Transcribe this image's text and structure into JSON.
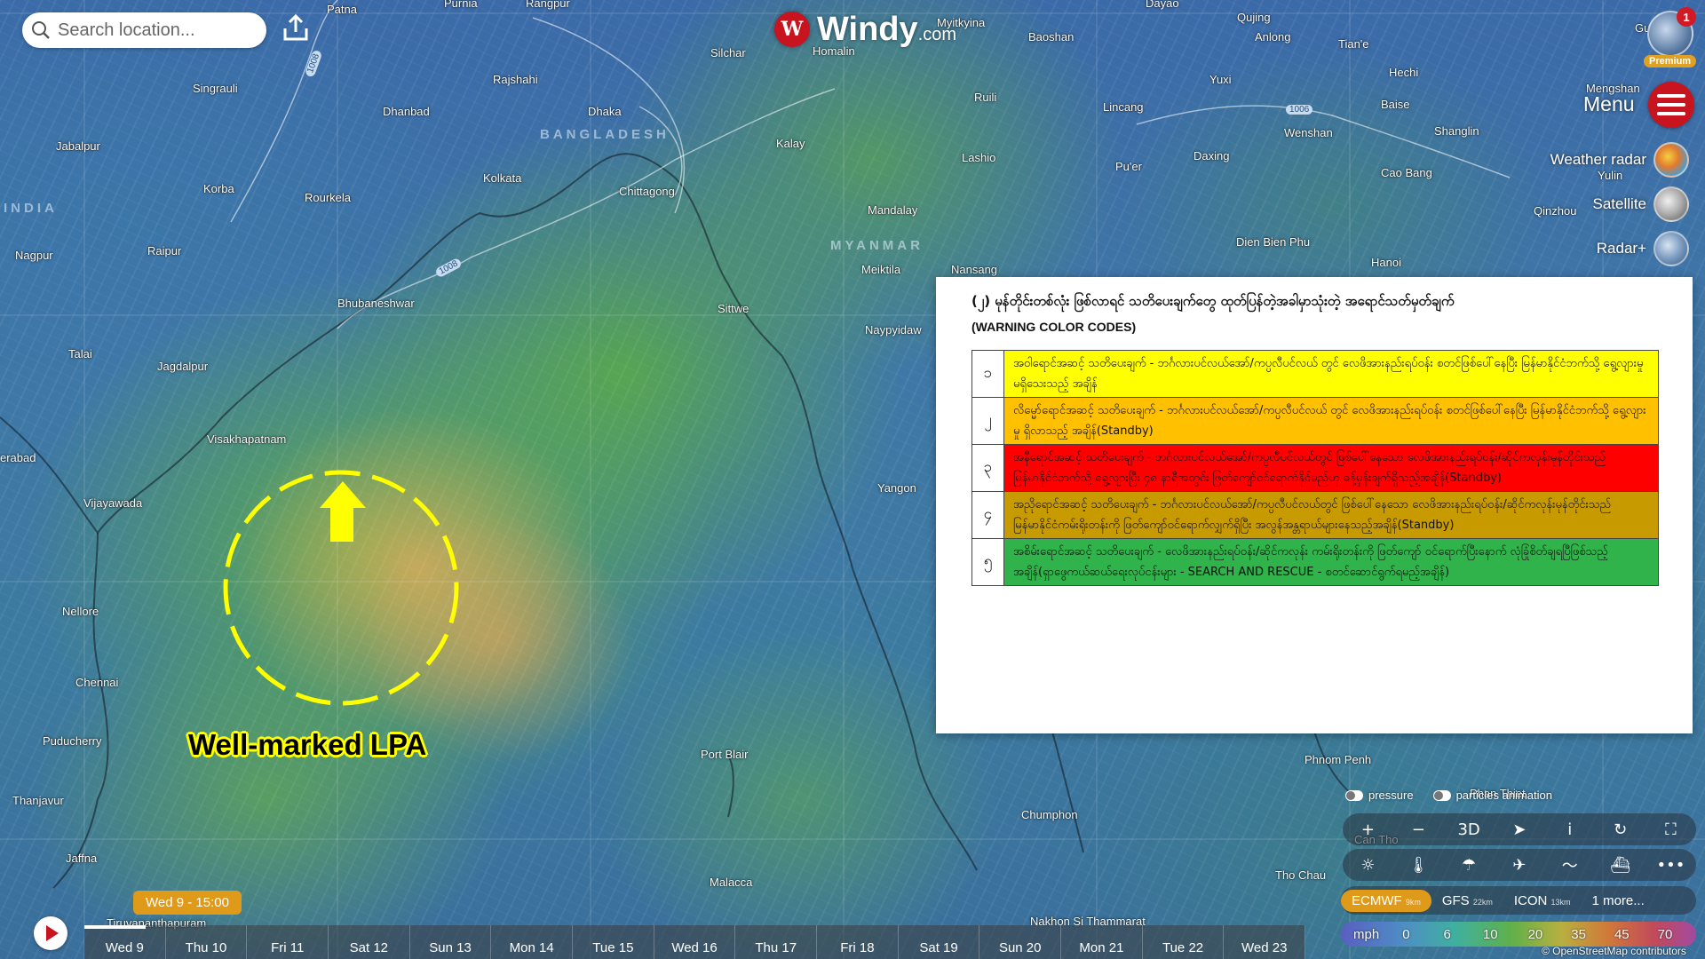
{
  "app": {
    "brand": "Windy",
    "brand_suffix": ".com",
    "logo_letter": "W"
  },
  "search": {
    "placeholder": "Search location..."
  },
  "user": {
    "notifications": "1",
    "badge": "Premium"
  },
  "menu": {
    "label": "Menu"
  },
  "layers": [
    {
      "label": "Weather radar",
      "icon": "radar-thumbnail"
    },
    {
      "label": "Satellite",
      "icon": "satellite-thumbnail"
    },
    {
      "label": "Radar+",
      "icon": "radar-plus-thumbnail"
    }
  ],
  "map": {
    "cities": [
      "Patna",
      "Purnia",
      "Rangpur",
      "Myitkyina",
      "Dayao",
      "Qujing",
      "Guilin",
      "Anlong",
      "Tian'e",
      "Silchar",
      "Homalin",
      "Baoshan",
      "Singrauli",
      "Rajshahi",
      "Dhaka",
      "Ruili",
      "Lincang",
      "Yuxi",
      "Baise",
      "Hechi",
      "Mengshan",
      "Jabalpur",
      "Dhanbad",
      "Kalay",
      "Lashio",
      "Pu'er",
      "Daxing",
      "Wenshan",
      "Shanglin",
      "Korba",
      "Rourkela",
      "Kolkata",
      "Chittagong",
      "Mandalay",
      "Cao Bang",
      "Yulin",
      "Qinzhou",
      "Nagpur",
      "Raipur",
      "Meiktila",
      "Nansang",
      "Dien Bien Phu",
      "Hanoi",
      "Bhubaneshwar",
      "Sittwe",
      "Naypyidaw",
      "Talai",
      "Jagdalpur",
      "Visakhapatnam",
      "erabad",
      "Vijayawada",
      "Yangon",
      "Nellore",
      "Chennai",
      "Puducherry",
      "Port Blair",
      "Thanjavur",
      "Jaffna",
      "Chumphon",
      "Phnom Penh",
      "Phan Thiet",
      "Tho Chau",
      "Malacca",
      "Nakhon Si Thammarat",
      "Can Tho",
      "Tiruvananthapuram"
    ],
    "countries": [
      "BANGLADESH",
      "MYANMAR",
      "INDIA"
    ],
    "isobars": [
      "1008",
      "1006",
      "1008"
    ],
    "annotation": "Well-marked LPA"
  },
  "warning_panel": {
    "title": "(၂) မုန်တိုင်းတစ်လုံး ဖြစ်လာရင် သတိပေးချက်တွေ ထုတ်ပြန်တဲ့အခါမှာသုံးတဲ့ အရောင်သတ်မှတ်ချက်",
    "subtitle": "(WARNING COLOR CODES)",
    "rows": [
      {
        "num": "၁",
        "color": "#ffff00",
        "text": "အဝါရောင်အဆင့် သတိပေးချက် - ဘင်္ဂလားပင်လယ်အော်/ကပ္ပလီပင်လယ် တွင် လေဖိအားနည်းရပ်ဝန်း စတင်ဖြစ်ပေါ်နေပြီး မြန်မာနိုင်ငံဘက်သို့ ရွေ့လျားမှု မရှိသေးသည့် အချိန်"
      },
      {
        "num": "၂",
        "color": "#ffc000",
        "text": "လိမ္မော်ရောင်အဆင့် သတိပေးချက် - ဘင်္ဂလားပင်လယ်အော်/ကပ္ပလီပင်လယ် တွင် လေဖိအားနည်းရပ်ဝန်း စတင်ဖြစ်ပေါ်နေပြီး မြန်မာနိုင်ငံဘက်သို့ ရွေ့လျားမှု ရှိလာသည့် အချိန်(Standby)"
      },
      {
        "num": "၃",
        "color": "#ff0000",
        "text": "အနီရောင်အဆင့် သတိပေးချက် - ဘင်္ဂလားပင်လယ်အော်/ကပ္ပလီပင်လယ်တွင် ဖြစ်ပေါ်နေသော လေဖိအားနည်းရပ်ဝန်း/ဆိုင်ကလုန်းမုန်တိုင်းသည် မြန်မာနိုင်ငံဘက်သို့ ရွေ့လျားပြီး ၄၈ နာရီအတွင်း ဖြတ်ကျော်ဝင်ရောက်နိုင်မည်ဟု ခန့်မှန်းချက်ရှိသည့်အချိန်(Standby)"
      },
      {
        "num": "၄",
        "color": "#c79a00",
        "text": "အညိုရောင်အဆင့် သတိပေးချက် - ဘင်္ဂလားပင်လယ်အော်/ကပ္ပလီပင်လယ်တွင် ဖြစ်ပေါ်နေသော လေဖိအားနည်းရပ်ဝန်း/ဆိုင်ကလုန်းမုန်တိုင်းသည် မြန်မာနိုင်ငံကမ်းရိုးတန်းကို ဖြတ်ကျော်ဝင်ရောက်လျှက်ရှိပြီး အလွန်အန္တရာယ်များနေသည့်အချိန်(Standby)"
      },
      {
        "num": "၅",
        "color": "#2fb34a",
        "text": "အစိမ်းရောင်အဆင့် သတိပေးချက် - လေဖိအားနည်းရပ်ဝန်း/ဆိုင်ကလုန်း ကမ်းရိုးတန်းကို ဖြတ်ကျော် ဝင်ရောက်ပြီးနောက် လုံခြုံစိတ်ချရပြီဖြစ်သည့်အချိန်(ရှာဖွေကယ်ဆယ်ရေးလုပ်ငန်းများ - SEARCH AND RESCUE - စတင်ဆောင်ရွက်ရမည့်အချိန်)"
      }
    ]
  },
  "overlays": {
    "pressure": "pressure",
    "particles": "particles animation"
  },
  "tools": [
    "+",
    "−",
    "3D",
    "➤",
    "i",
    "↻",
    "⛶"
  ],
  "layer_tools": [
    "wind-icon",
    "temperature-icon",
    "rain-icon",
    "plane-icon",
    "waves-icon",
    "ship-icon",
    "more-icon"
  ],
  "models": [
    {
      "name": "ECMWF",
      "res": "9km",
      "active": true
    },
    {
      "name": "GFS",
      "res": "22km",
      "active": false
    },
    {
      "name": "ICON",
      "res": "13km",
      "active": false
    },
    {
      "name": "1 more...",
      "res": "",
      "active": false
    }
  ],
  "scale": {
    "unit": "mph",
    "ticks": [
      "0",
      "6",
      "10",
      "20",
      "35",
      "45",
      "70"
    ]
  },
  "attribution": "© OpenStreetMap contributors",
  "timeline": {
    "current": "Wed 9 - 15:00",
    "progress": 0.05,
    "days": [
      "Wed 9",
      "Thu 10",
      "Fri 11",
      "Sat 12",
      "Sun 13",
      "Mon 14",
      "Tue 15",
      "Wed 16",
      "Thu 17",
      "Fri 18",
      "Sat 19",
      "Sun 20",
      "Mon 21",
      "Tue 22",
      "Wed 23"
    ]
  }
}
